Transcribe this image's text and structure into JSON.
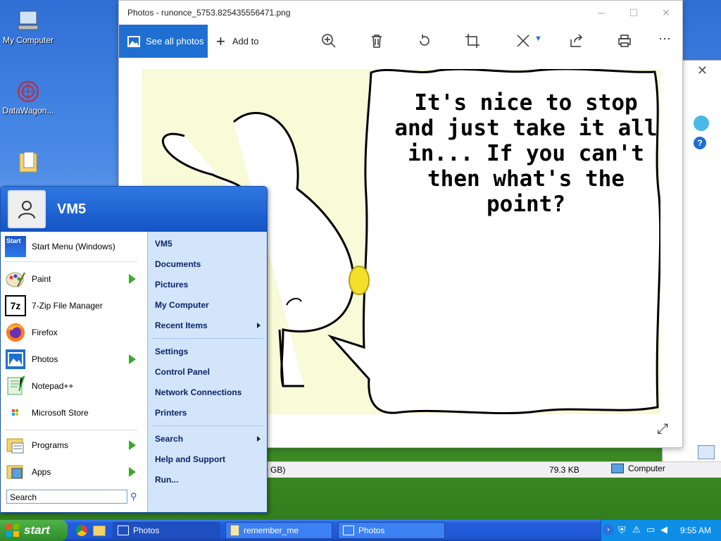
{
  "desktop": {
    "icons": [
      {
        "label": "My Computer"
      },
      {
        "label": "DataWagon..."
      },
      {
        "label": ""
      }
    ]
  },
  "photos_window": {
    "title": "Photos - runonce_5753.825435556471.png",
    "see_all": "See all photos",
    "add_to": "Add to",
    "comic_text": "It's nice to stop and just take it all in... If you can't then what's the point?"
  },
  "status_bar": {
    "left": "0 GB)",
    "size": "79.3 KB",
    "location": "Computer"
  },
  "start_menu": {
    "user": "VM5",
    "pinned": [
      {
        "label": "Start Menu (Windows)"
      },
      {
        "label": "Paint"
      },
      {
        "label": "7-Zip File Manager"
      },
      {
        "label": "Firefox"
      },
      {
        "label": "Photos"
      },
      {
        "label": "Notepad++"
      },
      {
        "label": "Microsoft Store"
      }
    ],
    "programs": "Programs",
    "apps": "Apps",
    "search_placeholder": "Search",
    "right": [
      "VM5",
      "Documents",
      "Pictures",
      "My Computer",
      "Recent Items",
      "Settings",
      "Control Panel",
      "Network Connections",
      "Printers",
      "Search",
      "Help and Support",
      "Run..."
    ]
  },
  "taskbar": {
    "start": "start",
    "tasks": [
      {
        "label": "Photos"
      },
      {
        "label": "remember_me"
      },
      {
        "label": "Photos"
      }
    ],
    "clock": "9:55 AM"
  },
  "colors": {
    "accent": "#1f6fd1",
    "taskbar": "#245edb",
    "start_green": "#3aaa2a"
  }
}
